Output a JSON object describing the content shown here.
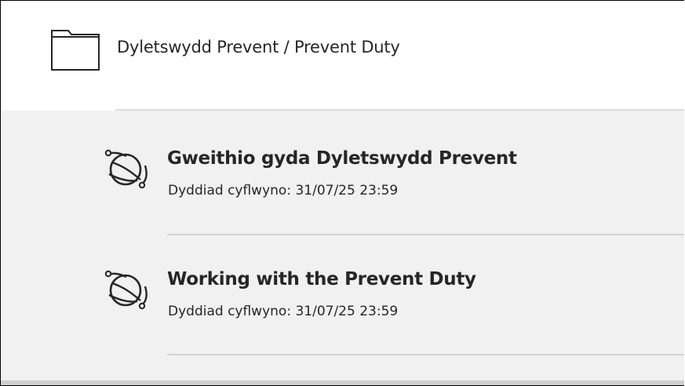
{
  "folder": {
    "title": "Dyletswydd Prevent / Prevent Duty",
    "icon": "folder-icon"
  },
  "items": [
    {
      "title": "Gweithio gyda Dyletswydd Prevent",
      "due": "Dyddiad cyflwyno: 31/07/25 23:59",
      "icon": "planet-orbit-icon"
    },
    {
      "title": "Working with the Prevent Duty",
      "due": "Dyddiad cyflwyno: 31/07/25 23:59",
      "icon": "planet-orbit-icon"
    }
  ],
  "colors": {
    "text": "#262626",
    "list_background": "#f1f1f1",
    "divider": "#d3d3d3"
  }
}
